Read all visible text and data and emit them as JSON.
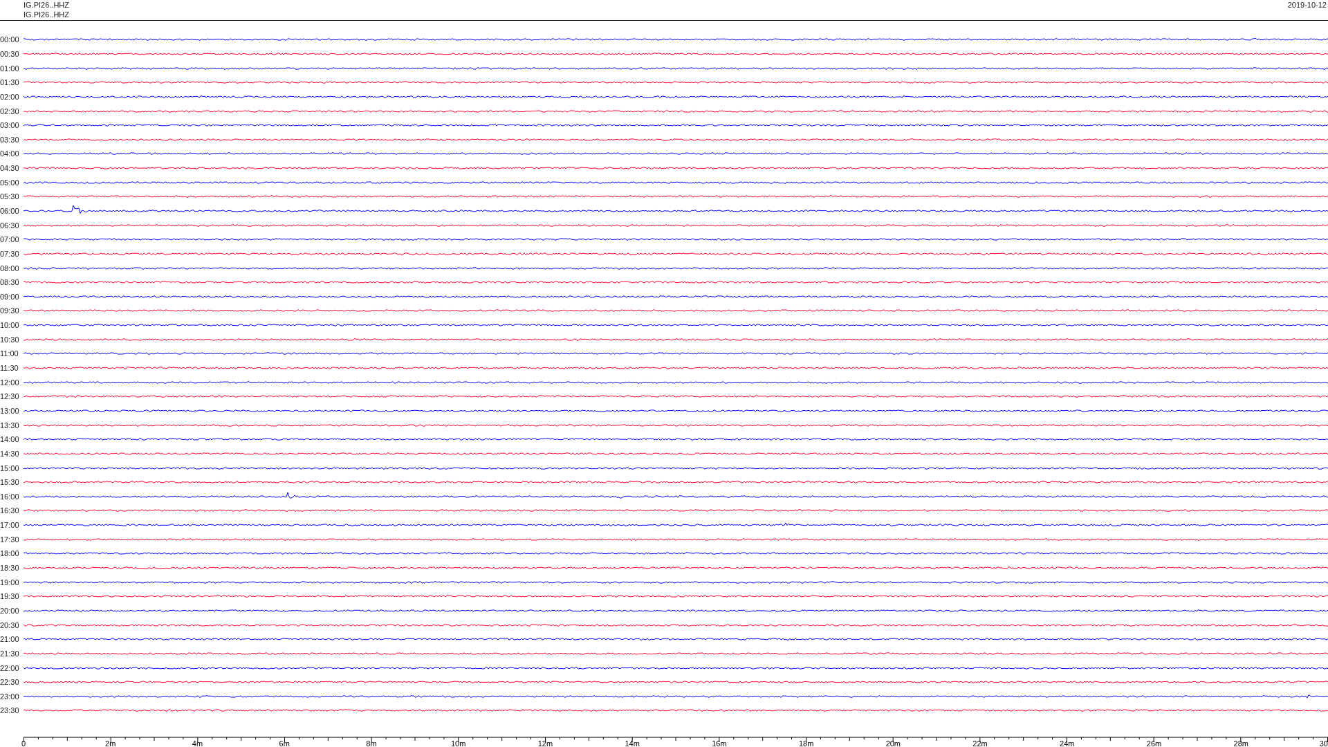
{
  "header": {
    "stations": [
      "IG.PI26..HHZ",
      "IG.PI26..HHZ"
    ],
    "date": "2019-10-12"
  },
  "rows": [
    {
      "time": "00:00",
      "color": "#0000ff"
    },
    {
      "time": "00:30",
      "color": "#ff0033"
    },
    {
      "time": "01:00",
      "color": "#0000ff"
    },
    {
      "time": "01:30",
      "color": "#ff0033"
    },
    {
      "time": "02:00",
      "color": "#0000ff"
    },
    {
      "time": "02:30",
      "color": "#ff0033"
    },
    {
      "time": "03:00",
      "color": "#0000ff"
    },
    {
      "time": "03:30",
      "color": "#ff0033"
    },
    {
      "time": "04:00",
      "color": "#0000ff"
    },
    {
      "time": "04:30",
      "color": "#ff0033"
    },
    {
      "time": "05:00",
      "color": "#0000ff"
    },
    {
      "time": "05:30",
      "color": "#ff0033"
    },
    {
      "time": "06:00",
      "color": "#0000ff"
    },
    {
      "time": "06:30",
      "color": "#ff0033"
    },
    {
      "time": "07:00",
      "color": "#0000ff"
    },
    {
      "time": "07:30",
      "color": "#ff0033"
    },
    {
      "time": "08:00",
      "color": "#0000ff"
    },
    {
      "time": "08:30",
      "color": "#ff0033"
    },
    {
      "time": "09:00",
      "color": "#0000ff"
    },
    {
      "time": "09:30",
      "color": "#ff0033"
    },
    {
      "time": "10:00",
      "color": "#0000ff"
    },
    {
      "time": "10:30",
      "color": "#ff0033"
    },
    {
      "time": "11:00",
      "color": "#0000ff"
    },
    {
      "time": "11:30",
      "color": "#ff0033"
    },
    {
      "time": "12:00",
      "color": "#0000ff"
    },
    {
      "time": "12:30",
      "color": "#ff0033"
    },
    {
      "time": "13:00",
      "color": "#0000ff"
    },
    {
      "time": "13:30",
      "color": "#ff0033"
    },
    {
      "time": "14:00",
      "color": "#0000ff"
    },
    {
      "time": "14:30",
      "color": "#ff0033"
    },
    {
      "time": "15:00",
      "color": "#0000ff"
    },
    {
      "time": "15:30",
      "color": "#ff0033"
    },
    {
      "time": "16:00",
      "color": "#0000ff"
    },
    {
      "time": "16:30",
      "color": "#ff0033"
    },
    {
      "time": "17:00",
      "color": "#0000ff"
    },
    {
      "time": "17:30",
      "color": "#ff0033"
    },
    {
      "time": "18:00",
      "color": "#0000ff"
    },
    {
      "time": "18:30",
      "color": "#ff0033"
    },
    {
      "time": "19:00",
      "color": "#0000ff"
    },
    {
      "time": "19:30",
      "color": "#ff0033"
    },
    {
      "time": "20:00",
      "color": "#0000ff"
    },
    {
      "time": "20:30",
      "color": "#ff0033"
    },
    {
      "time": "21:00",
      "color": "#0000ff"
    },
    {
      "time": "21:30",
      "color": "#ff0033"
    },
    {
      "time": "22:00",
      "color": "#0000ff"
    },
    {
      "time": "22:30",
      "color": "#ff0033"
    },
    {
      "time": "23:00",
      "color": "#0000ff"
    },
    {
      "time": "23:30",
      "color": "#ff0033"
    }
  ],
  "x_axis": {
    "labels": [
      "0",
      "2m",
      "4m",
      "6m",
      "8m",
      "10m",
      "12m",
      "14m",
      "16m",
      "18m",
      "20m",
      "22m",
      "24m",
      "26m",
      "28m",
      "30"
    ]
  }
}
